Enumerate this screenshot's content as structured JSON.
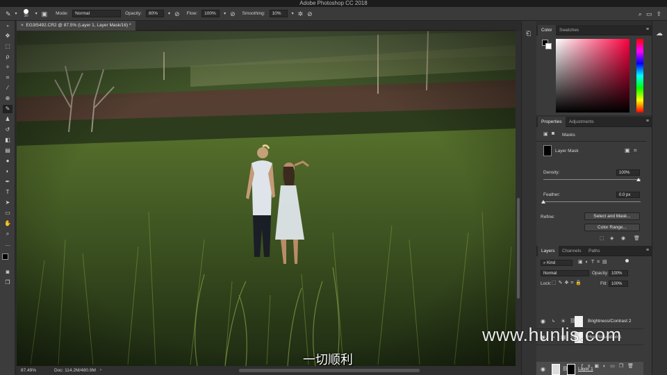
{
  "app": {
    "title": "Adobe Photoshop CC 2018"
  },
  "options": {
    "brush_size": "30",
    "mode_label": "Mode:",
    "mode_value": "Normal",
    "opacity_label": "Opacity:",
    "opacity_value": "80%",
    "flow_label": "Flow:",
    "flow_value": "100%",
    "smoothing_label": "Smoothing:",
    "smoothing_value": "10%"
  },
  "document": {
    "tab_title": "EG3I5492.CR2 @ 87.5% (Layer 1, Layer Mask/16) *"
  },
  "status": {
    "zoom": "87.49%",
    "doc_size": "Doc: 114.2M/480.9M"
  },
  "color_panel": {
    "tabs": [
      "Color",
      "Swatches"
    ],
    "accent_hue": "#ff0040"
  },
  "properties_panel": {
    "tabs": [
      "Properties",
      "Adjustments"
    ],
    "masks_label": "Masks",
    "layer_mask_label": "Layer Mask",
    "density_label": "Density:",
    "density_value": "100%",
    "feather_label": "Feather:",
    "feather_value": "0.0 px",
    "refine_label": "Refine:",
    "select_and_mask": "Select and Mask...",
    "color_range": "Color Range..."
  },
  "layers_panel": {
    "tabs": [
      "Layers",
      "Channels",
      "Paths"
    ],
    "filter_kind": "Kind",
    "blend_mode": "Normal",
    "opacity_label": "Opacity:",
    "opacity_value": "100%",
    "lock_label": "Lock:",
    "fill_label": "Fill:",
    "fill_value": "100%",
    "layers": [
      {
        "name": "Brightness/Contrast 2",
        "selected": false
      },
      {
        "name": "Hue/Saturation 1",
        "selected": false
      },
      {
        "name": "Layer 1",
        "selected": true
      }
    ]
  },
  "overlay": {
    "watermark": "www.hunlis.com",
    "subtitle": "一切顺利"
  }
}
